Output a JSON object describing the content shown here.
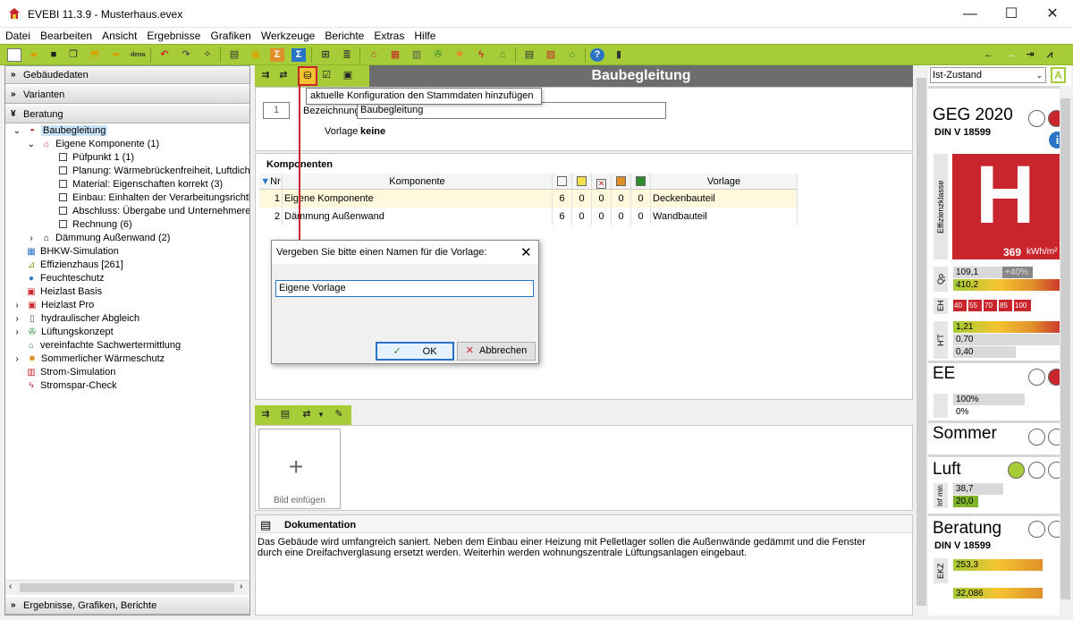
{
  "window": {
    "title": "EVEBI 11.3.9 - Musterhaus.evex",
    "minimize": "—",
    "maximize": "☐",
    "close": "✕"
  },
  "menu": [
    "Datei",
    "Bearbeiten",
    "Ansicht",
    "Ergebnisse",
    "Grafiken",
    "Werkzeuge",
    "Berichte",
    "Extras",
    "Hilfe"
  ],
  "sidebar": {
    "sections": {
      "gebaeude": "Gebäudedaten",
      "varianten": "Varianten",
      "beratung": "Beratung",
      "bottom": "Ergebnisse, Grafiken, Berichte"
    },
    "tree": [
      {
        "label": "Baubegleitung"
      },
      {
        "label": "Eigene Komponente (1)"
      },
      {
        "label": "Püfpunkt 1 (1)"
      },
      {
        "label": "Planung: Wärmebrückenfreiheit, Luftdichthe"
      },
      {
        "label": "Material: Eigenschaften korrekt (3)"
      },
      {
        "label": "Einbau: Einhalten der Verarbeitungsrichtlinie"
      },
      {
        "label": "Abschluss: Übergabe und Unternehmererkla"
      },
      {
        "label": "Rechnung (6)"
      },
      {
        "label": "Dämmung Außenwand (2)"
      },
      {
        "label": "BHKW-Simulation"
      },
      {
        "label": "Effizienzhaus [261]"
      },
      {
        "label": "Feuchteschutz"
      },
      {
        "label": "Heizlast Basis"
      },
      {
        "label": "Heizlast Pro"
      },
      {
        "label": "hydraulischer Abgleich"
      },
      {
        "label": "Lüftungskonzept"
      },
      {
        "label": "vereinfachte Sachwertermittlung"
      },
      {
        "label": "Sommerlicher Wärmeschutz"
      },
      {
        "label": "Strom-Simulation"
      },
      {
        "label": "Stromspar-Check"
      }
    ]
  },
  "main": {
    "header": "Baubegleitung",
    "tooltip": "aktuelle Konfiguration den Stammdaten hinzufügen",
    "number": "1",
    "bezeichnung_label": "Bezeichnung",
    "bezeichnung_value": "Baubegleitung",
    "vorlage_label": "Vorlage",
    "vorlage_value": "keine",
    "komponenten_title": "Komponenten",
    "table": {
      "headers": {
        "nr": "Nr",
        "komponente": "Komponente",
        "vorlage": "Vorlage"
      },
      "rows": [
        {
          "nr": "1",
          "komponente": "Eigene Komponente",
          "c1": "6",
          "c2": "0",
          "c3": "0",
          "c4": "0",
          "c5": "0",
          "vorlage": "Deckenbauteil"
        },
        {
          "nr": "2",
          "komponente": "Dämmung Außenwand",
          "c1": "6",
          "c2": "0",
          "c3": "0",
          "c4": "0",
          "c5": "0",
          "vorlage": "Wandbauteil"
        }
      ]
    },
    "bild_label": "Bild einfügen",
    "doku_title": "Dokumentation",
    "doku_text": "Das Gebäude wird umfangreich saniert. Neben dem Einbau einer Heizung mit Pelletlager sollen die Außenwände gedämmt und die Fenster durch eine Dreifachverglasung ersetzt werden. Weiterhin werden wohnungszentrale Lüftungsanlagen eingebaut."
  },
  "dialog": {
    "title": "Vergeben Sie bitte einen Namen für die Vorlage:",
    "input_value": "Eigene Vorlage",
    "ok": "OK",
    "cancel": "Abbrechen"
  },
  "right": {
    "select": "Ist-Zustand",
    "badge": "A",
    "geg_title": "GEG 2020",
    "geg_sub": "DIN V 18599",
    "effizienz_label": "Effizienzklasse",
    "class_letter": "H",
    "class_value": "369",
    "class_unit": "kWh/m²",
    "qp_label": "Qp",
    "qp_v1": "109,1",
    "qp_pct": "+40%",
    "qp_v2": "410,2",
    "eh_label": "EH",
    "eh_values": [
      "40",
      "55",
      "70",
      "85",
      "100"
    ],
    "ht_label": "H'T",
    "ht_v1": "1,21",
    "ht_v2": "0,70",
    "ht_v3": "0,40",
    "ee_title": "EE",
    "ee_v1": "100%",
    "ee_v2": "0%",
    "sommer_title": "Sommer",
    "luft_title": "Luft",
    "luft_label": "Inf min",
    "luft_v1": "38,7",
    "luft_v2": "20,0",
    "beratung_title": "Beratung",
    "beratung_sub": "DIN V 18599",
    "ekz_label": "EKZ",
    "ekz_v1": "253,3",
    "co2_v": "32,086",
    "colors": {
      "green": "#a6cc38",
      "red": "#c8262c",
      "dark": "#6d6d6d"
    }
  }
}
